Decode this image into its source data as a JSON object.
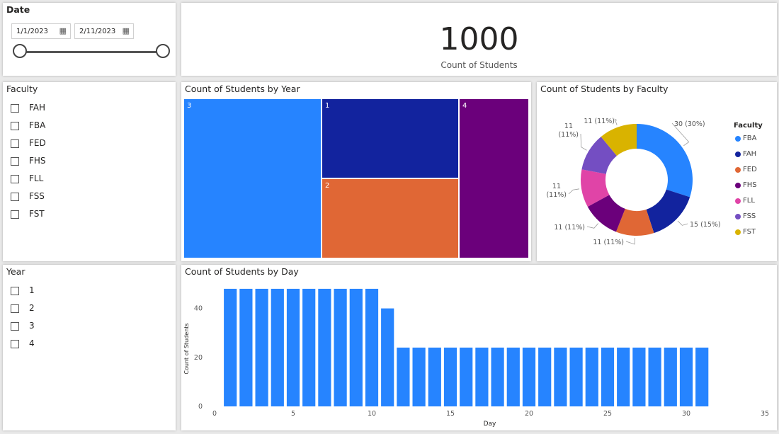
{
  "date_slicer": {
    "title": "Date",
    "start": "1/1/2023",
    "end": "2/11/2023",
    "range": [
      0,
      1
    ]
  },
  "kpi": {
    "value": "1000",
    "label": "Count of Students"
  },
  "faculty_slicer": {
    "title": "Faculty",
    "items": [
      "FAH",
      "FBA",
      "FED",
      "FHS",
      "FLL",
      "FSS",
      "FST"
    ]
  },
  "year_slicer": {
    "title": "Year",
    "items": [
      "1",
      "2",
      "3",
      "4"
    ]
  },
  "colors": {
    "blue": "#2684ff",
    "navy": "#12239e",
    "orange": "#e06735",
    "purple": "#6b007b",
    "pink": "#e044a7",
    "violet": "#744ec2",
    "gold": "#d9b300"
  },
  "chart_data": [
    {
      "type": "treemap",
      "title": "Count of Students by Year",
      "items": [
        {
          "label": "3",
          "color": "#2684ff"
        },
        {
          "label": "1",
          "color": "#12239e"
        },
        {
          "label": "2",
          "color": "#e06735"
        },
        {
          "label": "4",
          "color": "#6b007b"
        }
      ]
    },
    {
      "type": "pie",
      "title": "Count of Students by Faculty",
      "legend_title": "Faculty",
      "legend_position": "right",
      "slices": [
        {
          "name": "FBA",
          "value": 30,
          "label": "30 (30%)",
          "color": "#2684ff"
        },
        {
          "name": "FAH",
          "value": 15,
          "label": "15 (15%)",
          "color": "#12239e"
        },
        {
          "name": "FED",
          "value": 11,
          "label": "11 (11%)",
          "color": "#e06735"
        },
        {
          "name": "FHS",
          "value": 11,
          "label": "11 (11%)",
          "color": "#6b007b"
        },
        {
          "name": "FLL",
          "value": 11,
          "label": "11 (11%)",
          "color": "#e044a7"
        },
        {
          "name": "FSS",
          "value": 11,
          "label": "11 (11%)",
          "color": "#744ec2"
        },
        {
          "name": "FST",
          "value": 11,
          "label": "11 (11%)",
          "color": "#d9b300"
        }
      ]
    },
    {
      "type": "bar",
      "title": "Count of Students by Day",
      "xlabel": "Day",
      "ylabel": "Count of Students",
      "xlim": [
        0,
        35
      ],
      "ylim": [
        0,
        50
      ],
      "xticks": [
        0,
        5,
        10,
        15,
        20,
        25,
        30,
        35
      ],
      "yticks": [
        0,
        20,
        40
      ],
      "color": "#2684ff",
      "x": [
        1,
        2,
        3,
        4,
        5,
        6,
        7,
        8,
        9,
        10,
        11,
        12,
        13,
        14,
        15,
        16,
        17,
        18,
        19,
        20,
        21,
        22,
        23,
        24,
        25,
        26,
        27,
        28,
        29,
        30,
        31
      ],
      "values": [
        48,
        48,
        48,
        48,
        48,
        48,
        48,
        48,
        48,
        48,
        40,
        24,
        24,
        24,
        24,
        24,
        24,
        24,
        24,
        24,
        24,
        24,
        24,
        24,
        24,
        24,
        24,
        24,
        24,
        24,
        24
      ]
    }
  ]
}
